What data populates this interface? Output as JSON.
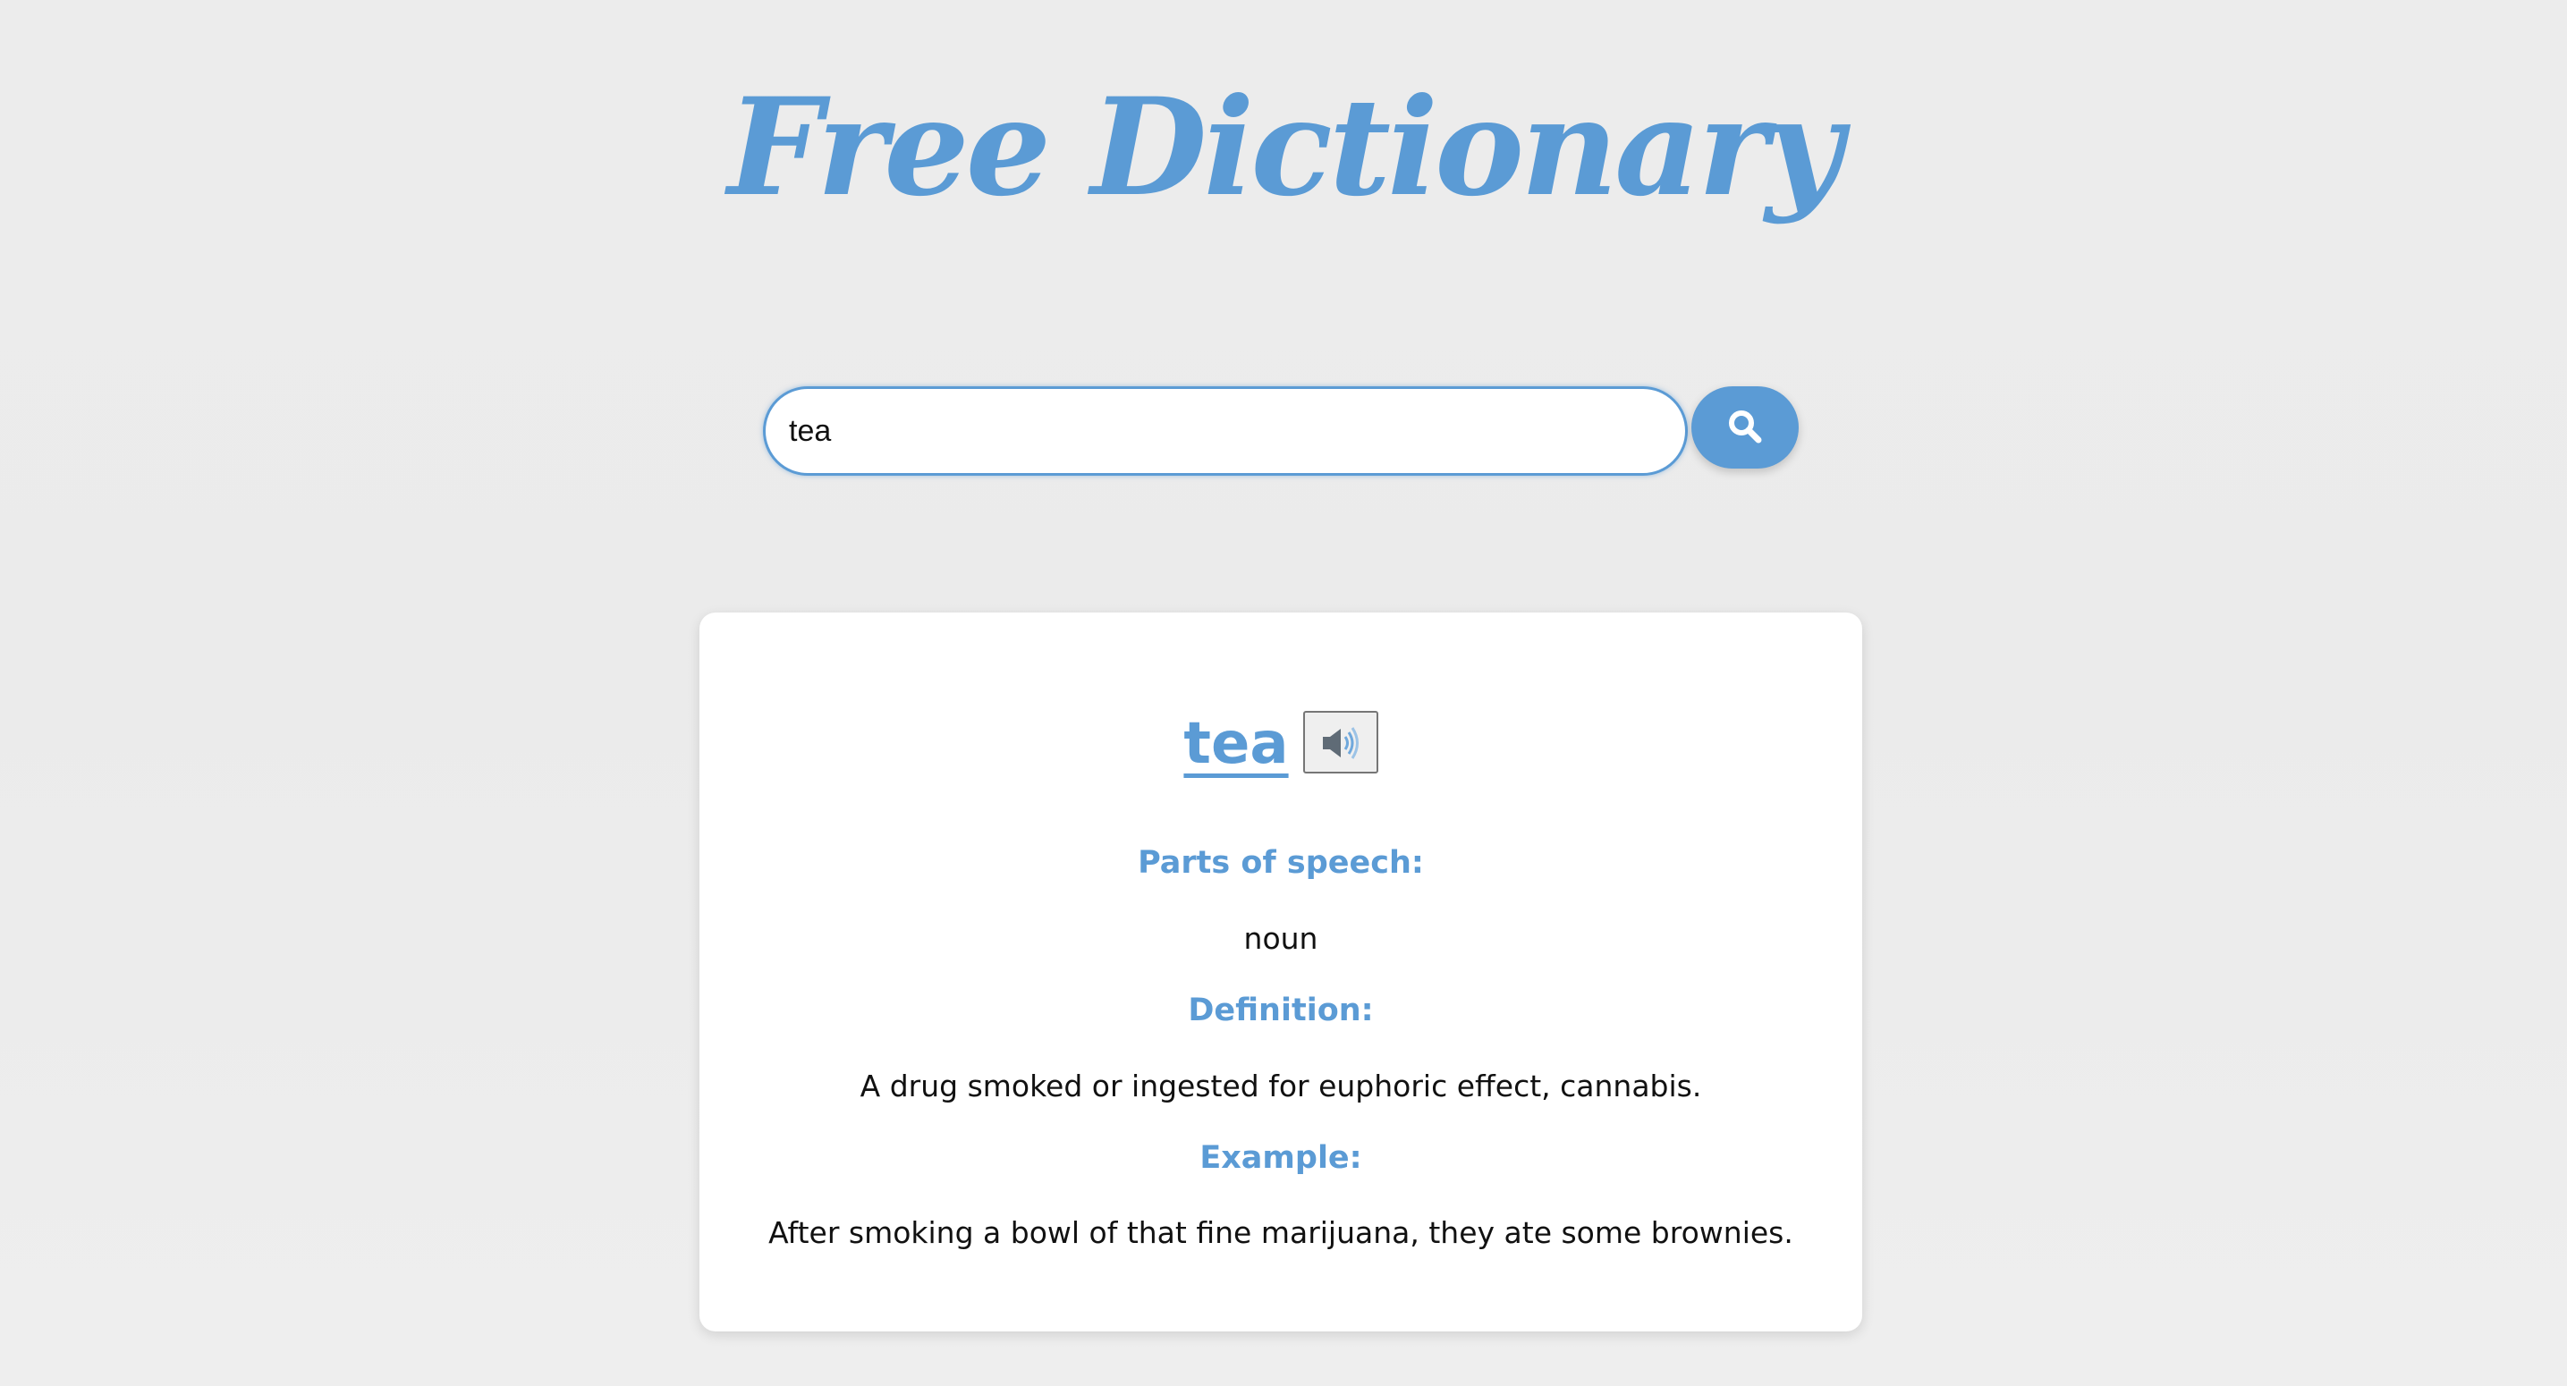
{
  "app": {
    "title": "Free Dictionary"
  },
  "search": {
    "value": "tea",
    "button_icon": "search-icon"
  },
  "result": {
    "word": "tea",
    "audio_icon": "speaker-icon",
    "parts_of_speech_heading": "Parts of speech:",
    "parts_of_speech": "noun",
    "definition_heading": "Definition:",
    "definition": "A drug smoked or ingested for euphoric effect, cannabis.",
    "example_heading": "Example:",
    "example": "After smoking a bowl of that fine marijuana, they ate some brownies."
  },
  "colors": {
    "accent": "#5b9bd5",
    "background": "#ececec",
    "card": "#ffffff",
    "text": "#111111"
  }
}
